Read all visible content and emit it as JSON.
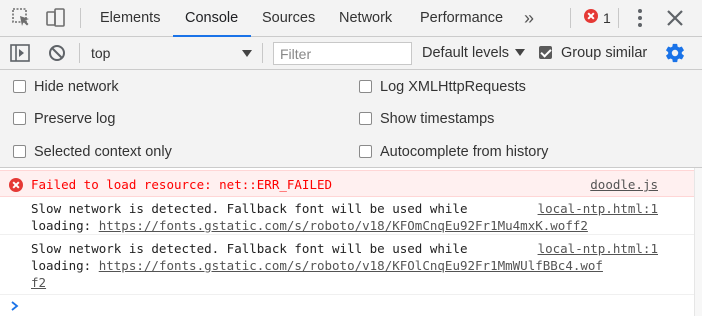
{
  "tabbar": {
    "icons": [
      "inspect-element-icon",
      "device-toolbar-icon"
    ],
    "tabs": [
      {
        "label": "Elements",
        "active": false
      },
      {
        "label": "Console",
        "active": true
      },
      {
        "label": "Sources",
        "active": false
      },
      {
        "label": "Network",
        "active": false
      },
      {
        "label": "Performance",
        "active": false
      }
    ],
    "more_tabs": "»",
    "error_count": "1"
  },
  "toolbar": {
    "context": "top",
    "filter_placeholder": "Filter",
    "levels": "Default levels",
    "group_similar": "Group similar",
    "group_similar_checked": true
  },
  "settings": {
    "options_left": [
      {
        "label": "Hide network",
        "checked": false
      },
      {
        "label": "Preserve log",
        "checked": false
      },
      {
        "label": "Selected context only",
        "checked": false
      }
    ],
    "options_right": [
      {
        "label": "Log XMLHttpRequests",
        "checked": false
      },
      {
        "label": "Show timestamps",
        "checked": false
      },
      {
        "label": "Autocomplete from history",
        "checked": false
      }
    ]
  },
  "messages": [
    {
      "level": "error",
      "text": "Failed to load resource: net::ERR_FAILED",
      "source": "doodle.js"
    },
    {
      "level": "log",
      "line1": "Slow network is detected. Fallback font will be used while",
      "line2_prefix": "loading: ",
      "url_part1": "https://fonts.gstatic.com/s/roboto/v18/KFOmCnqEu92Fr1Mu4mxK.woff2",
      "url_part2": "",
      "source": "local-ntp.html:1"
    },
    {
      "level": "log",
      "line1": "Slow network is detected. Fallback font will be used while",
      "line2_prefix": "loading: ",
      "url_part1": "https://fonts.gstatic.com/s/roboto/v18/KFOlCnqEu92Fr1MmWUlfBBc4.wof",
      "url_part2": "f2",
      "source": "local-ntp.html:1"
    }
  ],
  "colors": {
    "accent": "#1a73e8",
    "error_text": "#ff0000",
    "error_bg": "#fff0f0",
    "settings_gear": "#1a73e8"
  }
}
